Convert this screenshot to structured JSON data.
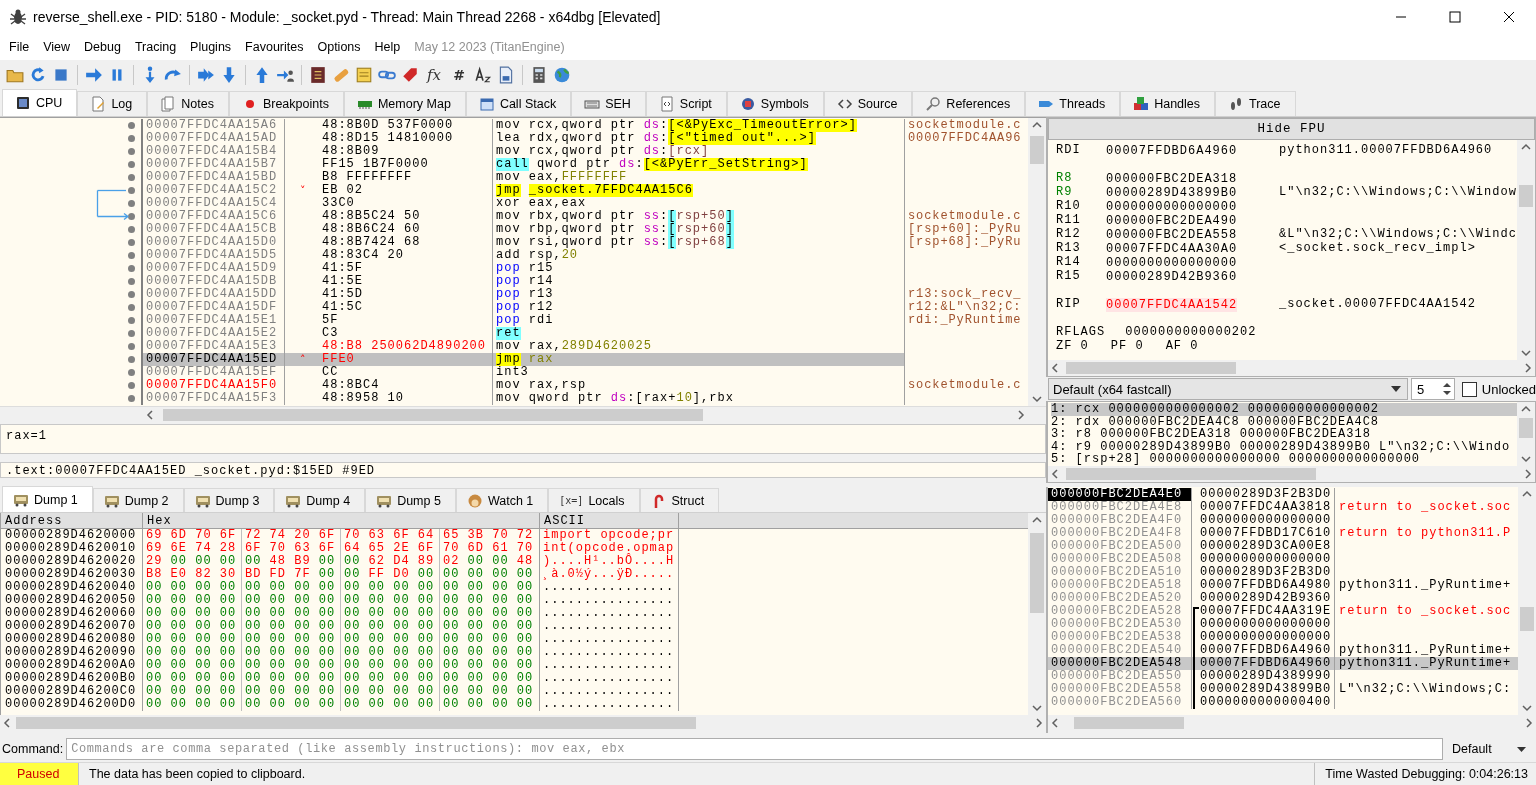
{
  "window": {
    "title": "reverse_shell.exe - PID: 5180 - Module: _socket.pyd - Thread: Main Thread 2268 - x64dbg [Elevated]"
  },
  "menu": {
    "items": [
      "File",
      "View",
      "Debug",
      "Tracing",
      "Plugins",
      "Favourites",
      "Options",
      "Help"
    ],
    "build": "May 12 2023 (TitanEngine)"
  },
  "toolbar": {
    "glyphs": [
      "fx",
      "#"
    ]
  },
  "tabs": [
    {
      "label": "CPU",
      "selected": true
    },
    {
      "label": "Log",
      "selected": false
    },
    {
      "label": "Notes",
      "selected": false
    },
    {
      "label": "Breakpoints",
      "selected": false
    },
    {
      "label": "Memory Map",
      "selected": false
    },
    {
      "label": "Call Stack",
      "selected": false
    },
    {
      "label": "SEH",
      "selected": false
    },
    {
      "label": "Script",
      "selected": false
    },
    {
      "label": "Symbols",
      "selected": false
    },
    {
      "label": "Source",
      "selected": false
    },
    {
      "label": "References",
      "selected": false
    },
    {
      "label": "Threads",
      "selected": false
    },
    {
      "label": "Handles",
      "selected": false
    },
    {
      "label": "Trace",
      "selected": false
    }
  ],
  "disassembly": {
    "rows": [
      {
        "address": "00007FFDC4AA15A6",
        "bytes": "48:8B0D 537F0000",
        "patched": false,
        "jump_source": false,
        "jump_target": false,
        "tokens": [
          {
            "text": "mov",
            "kind": "mnemonic"
          },
          {
            "text": "rcx,qword ptr ",
            "kind": "plain"
          },
          {
            "text": "ds",
            "kind": "seg"
          },
          {
            "text": ":",
            "kind": "plain"
          },
          {
            "text": "[<&PyExc_TimeoutError>]",
            "kind": "sym"
          }
        ],
        "comment": "socketmodule.c",
        "selected": false,
        "address_highlight": false
      },
      {
        "address": "00007FFDC4AA15AD",
        "bytes": "48:8D15 14810000",
        "patched": false,
        "jump_source": false,
        "jump_target": false,
        "tokens": [
          {
            "text": "lea",
            "kind": "mnemonic"
          },
          {
            "text": "rdx,qword ptr ",
            "kind": "plain"
          },
          {
            "text": "ds",
            "kind": "seg"
          },
          {
            "text": ":",
            "kind": "plain"
          },
          {
            "text": "[<\"timed out\"...>]",
            "kind": "sym"
          }
        ],
        "comment": "00007FFDC4AA96",
        "selected": false,
        "address_highlight": false
      },
      {
        "address": "00007FFDC4AA15B4",
        "bytes": "48:8B09",
        "patched": false,
        "jump_source": false,
        "jump_target": false,
        "tokens": [
          {
            "text": "mov",
            "kind": "mnemonic"
          },
          {
            "text": "rcx,qword ptr ",
            "kind": "plain"
          },
          {
            "text": "ds",
            "kind": "seg"
          },
          {
            "text": ":",
            "kind": "plain"
          },
          {
            "text": "[rcx]",
            "kind": "mem"
          }
        ],
        "selected": false,
        "address_highlight": false
      },
      {
        "address": "00007FFDC4AA15B7",
        "bytes": "FF15 1B7F0000",
        "patched": false,
        "jump_source": false,
        "jump_target": false,
        "tokens": [
          {
            "text": "call",
            "kind": "call"
          },
          {
            "text": "qword ptr ",
            "kind": "plain"
          },
          {
            "text": "ds",
            "kind": "seg"
          },
          {
            "text": ":",
            "kind": "plain"
          },
          {
            "text": "[<&PyErr_SetString>]",
            "kind": "sym"
          }
        ],
        "selected": false,
        "address_highlight": false
      },
      {
        "address": "00007FFDC4AA15BD",
        "bytes": "B8 FFFFFFFF",
        "patched": false,
        "jump_source": false,
        "jump_target": false,
        "tokens": [
          {
            "text": "mov",
            "kind": "mnemonic"
          },
          {
            "text": "eax,",
            "kind": "plain"
          },
          {
            "text": "FFFFFFFF",
            "kind": "num"
          }
        ],
        "selected": false,
        "address_highlight": false
      },
      {
        "address": "00007FFDC4AA15C2",
        "jump_mark": "˅",
        "bytes": "EB 02",
        "patched": false,
        "jump_source": true,
        "jump_target": false,
        "tokens": [
          {
            "text": "jmp",
            "kind": "jmp"
          },
          {
            "text": "_socket.7FFDC4AA15C6",
            "kind": "sym"
          }
        ],
        "selected": false,
        "address_highlight": false
      },
      {
        "address": "00007FFDC4AA15C4",
        "bytes": "33C0",
        "patched": false,
        "jump_source": false,
        "jump_target": false,
        "tokens": [
          {
            "text": "xor",
            "kind": "mnemonic"
          },
          {
            "text": "eax,eax",
            "kind": "plain"
          }
        ],
        "selected": false,
        "address_highlight": false
      },
      {
        "address": "00007FFDC4AA15C6",
        "bytes": "48:8B5C24 50",
        "patched": false,
        "jump_source": false,
        "jump_target": true,
        "tokens": [
          {
            "text": "mov",
            "kind": "mnemonic"
          },
          {
            "text": "rbx,qword ptr ",
            "kind": "plain"
          },
          {
            "text": "ss",
            "kind": "seg"
          },
          {
            "text": ":",
            "kind": "plain"
          },
          {
            "text": "[rsp+50]",
            "kind": "stack"
          }
        ],
        "comment": "socketmodule.c",
        "selected": false,
        "address_highlight": false
      },
      {
        "address": "00007FFDC4AA15CB",
        "bytes": "48:8B6C24 60",
        "patched": false,
        "jump_source": false,
        "jump_target": false,
        "tokens": [
          {
            "text": "mov",
            "kind": "mnemonic"
          },
          {
            "text": "rbp,qword ptr ",
            "kind": "plain"
          },
          {
            "text": "ss",
            "kind": "seg"
          },
          {
            "text": ":",
            "kind": "plain"
          },
          {
            "text": "[rsp+60]",
            "kind": "stack"
          }
        ],
        "comment": "[rsp+60]:_PyRu",
        "selected": false,
        "address_highlight": false
      },
      {
        "address": "00007FFDC4AA15D0",
        "bytes": "48:8B7424 68",
        "patched": false,
        "jump_source": false,
        "jump_target": false,
        "tokens": [
          {
            "text": "mov",
            "kind": "mnemonic"
          },
          {
            "text": "rsi,qword ptr ",
            "kind": "plain"
          },
          {
            "text": "ss",
            "kind": "seg"
          },
          {
            "text": ":",
            "kind": "plain"
          },
          {
            "text": "[rsp+68]",
            "kind": "stack"
          }
        ],
        "comment": "[rsp+68]:_PyRu",
        "selected": false,
        "address_highlight": false
      },
      {
        "address": "00007FFDC4AA15D5",
        "bytes": "48:83C4 20",
        "patched": false,
        "jump_source": false,
        "jump_target": false,
        "tokens": [
          {
            "text": "add",
            "kind": "mnemonic"
          },
          {
            "text": "rsp,",
            "kind": "plain"
          },
          {
            "text": "20",
            "kind": "num"
          }
        ],
        "selected": false,
        "address_highlight": false
      },
      {
        "address": "00007FFDC4AA15D9",
        "bytes": "41:5F",
        "patched": false,
        "jump_source": false,
        "jump_target": false,
        "tokens": [
          {
            "text": "pop",
            "kind": "pop"
          },
          {
            "text": "r15",
            "kind": "plain"
          }
        ],
        "selected": false,
        "address_highlight": false
      },
      {
        "address": "00007FFDC4AA15DB",
        "bytes": "41:5E",
        "patched": false,
        "jump_source": false,
        "jump_target": false,
        "tokens": [
          {
            "text": "pop",
            "kind": "pop"
          },
          {
            "text": "r14",
            "kind": "plain"
          }
        ],
        "selected": false,
        "address_highlight": false
      },
      {
        "address": "00007FFDC4AA15DD",
        "bytes": "41:5D",
        "patched": false,
        "jump_source": false,
        "jump_target": false,
        "tokens": [
          {
            "text": "pop",
            "kind": "pop"
          },
          {
            "text": "r13",
            "kind": "plain"
          }
        ],
        "comment": "r13:sock_recv_",
        "selected": false,
        "address_highlight": false
      },
      {
        "address": "00007FFDC4AA15DF",
        "bytes": "41:5C",
        "patched": false,
        "jump_source": false,
        "jump_target": false,
        "tokens": [
          {
            "text": "pop",
            "kind": "pop"
          },
          {
            "text": "r12",
            "kind": "plain"
          }
        ],
        "comment": "r12:&L\"\\n32;C:",
        "selected": false,
        "address_highlight": false
      },
      {
        "address": "00007FFDC4AA15E1",
        "bytes": "5F",
        "patched": false,
        "jump_source": false,
        "jump_target": false,
        "tokens": [
          {
            "text": "pop",
            "kind": "pop"
          },
          {
            "text": "rdi",
            "kind": "plain"
          }
        ],
        "comment": "rdi:_PyRuntime",
        "selected": false,
        "address_highlight": false
      },
      {
        "address": "00007FFDC4AA15E2",
        "bytes": "C3",
        "patched": false,
        "jump_source": false,
        "jump_target": false,
        "tokens": [
          {
            "text": "ret",
            "kind": "call"
          }
        ],
        "selected": false,
        "address_highlight": false
      },
      {
        "address": "00007FFDC4AA15E3",
        "bytes": "48:B8 250062D4890200",
        "patched": true,
        "jump_source": false,
        "jump_target": false,
        "tokens": [
          {
            "text": "mov",
            "kind": "mnemonic"
          },
          {
            "text": "rax,",
            "kind": "plain"
          },
          {
            "text": "289D4620025",
            "kind": "num"
          }
        ],
        "selected": false,
        "address_highlight": false
      },
      {
        "address": "00007FFDC4AA15ED",
        "jump_mark": "˄",
        "bytes": "FFE0",
        "patched": true,
        "jump_source": false,
        "jump_target": false,
        "tokens": [
          {
            "text": "jmp",
            "kind": "jmp"
          },
          {
            "text": "rax",
            "kind": "num"
          }
        ],
        "selected": true,
        "address_highlight": false
      },
      {
        "address": "00007FFDC4AA15EF",
        "bytes": "CC",
        "patched": false,
        "jump_source": false,
        "jump_target": false,
        "tokens": [
          {
            "text": "int3",
            "kind": "mnemonic"
          }
        ],
        "selected": false,
        "address_highlight": false
      },
      {
        "address": "00007FFDC4AA15F0",
        "bytes": "48:8BC4",
        "patched": false,
        "jump_source": false,
        "jump_target": false,
        "tokens": [
          {
            "text": "mov",
            "kind": "mnemonic"
          },
          {
            "text": "rax,rsp",
            "kind": "plain"
          }
        ],
        "comment": "socketmodule.c",
        "selected": false,
        "address_highlight": true
      },
      {
        "address": "00007FFDC4AA15F3",
        "bytes": "48:8958 10",
        "patched": false,
        "jump_source": false,
        "jump_target": false,
        "tokens": [
          {
            "text": "mov",
            "kind": "mnemonic"
          },
          {
            "text": "qword ptr ",
            "kind": "plain"
          },
          {
            "text": "ds",
            "kind": "seg"
          },
          {
            "text": ":",
            "kind": "plain"
          },
          {
            "text": "[rax+",
            "kind": "plain"
          },
          {
            "text": "10",
            "kind": "num"
          },
          {
            "text": "],rbx",
            "kind": "plain"
          }
        ],
        "selected": false,
        "address_highlight": false
      }
    ]
  },
  "info": {
    "lines": [
      "rax=1",
      ".text:00007FFDC4AA15ED _socket.pyd:$15ED #9ED"
    ]
  },
  "registers": {
    "button": "Hide FPU",
    "rows": [
      {
        "kind": "reg",
        "name": "RDI",
        "value": "00007FFDBD6A4960",
        "comment": "python311.00007FFDBD6A4960",
        "changed": false
      },
      {
        "kind": "gap"
      },
      {
        "kind": "reg",
        "name": "R8",
        "value": "000000FBC2DEA318",
        "changed": true
      },
      {
        "kind": "reg",
        "name": "R9",
        "value": "00000289D43899B0",
        "comment": "L\"\\n32;C:\\\\Windows;C:\\\\Window",
        "changed": true
      },
      {
        "kind": "reg",
        "name": "R10",
        "value": "0000000000000000",
        "changed": false
      },
      {
        "kind": "reg",
        "name": "R11",
        "value": "000000FBC2DEA490",
        "changed": false
      },
      {
        "kind": "reg",
        "name": "R12",
        "value": "000000FBC2DEA558",
        "comment": "&L\"\\n32;C:\\\\Windows;C:\\\\Windc",
        "changed": false
      },
      {
        "kind": "reg",
        "name": "R13",
        "value": "00007FFDC4AA30A0",
        "comment": "<_socket.sock_recv_impl>",
        "changed": false
      },
      {
        "kind": "reg",
        "name": "R14",
        "value": "0000000000000000",
        "changed": false
      },
      {
        "kind": "reg",
        "name": "R15",
        "value": "00000289D42B9360",
        "changed": false
      },
      {
        "kind": "gap"
      },
      {
        "kind": "ip",
        "name": "RIP",
        "value": "00007FFDC4AA1542",
        "comment": "_socket.00007FFDC4AA1542",
        "changed": false
      },
      {
        "kind": "gap"
      },
      {
        "kind": "flags",
        "name": "RFLAGS",
        "value": "0000000000000202",
        "changed": false
      }
    ],
    "flags": [
      {
        "name": "ZF",
        "value": "0"
      },
      {
        "name": "PF",
        "value": "0"
      },
      {
        "name": "AF",
        "value": "0"
      }
    ]
  },
  "call_convention": {
    "value": "Default (x64 fastcall)",
    "count": "5",
    "unlocked_label": "Unlocked",
    "unlocked": false,
    "args": [
      {
        "text": "1: rcx 0000000000000002 0000000000000002",
        "selected": true
      },
      {
        "text": "2: rdx 000000FBC2DEA4C8 000000FBC2DEA4C8",
        "selected": false
      },
      {
        "text": "3: r8 000000FBC2DEA318 000000FBC2DEA318",
        "selected": false
      },
      {
        "text": "4: r9 00000289D43899B0 00000289D43899B0 L\"\\n32;C:\\\\Windo",
        "selected": false
      },
      {
        "text": "5: [rsp+28] 0000000000000000 0000000000000000",
        "selected": false
      }
    ]
  },
  "dump_tabs": [
    {
      "label": "Dump 1",
      "selected": true
    },
    {
      "label": "Dump 2",
      "selected": false
    },
    {
      "label": "Dump 3",
      "selected": false
    },
    {
      "label": "Dump 4",
      "selected": false
    },
    {
      "label": "Dump 5",
      "selected": false
    },
    {
      "label": "Watch 1",
      "selected": false
    },
    {
      "label": "Locals",
      "glyph": "[x=]",
      "selected": false
    },
    {
      "label": "Struct",
      "selected": false
    }
  ],
  "dump": {
    "columns": [
      "Address",
      "Hex",
      "ASCII"
    ],
    "rows": [
      {
        "address": "00000289D4620000",
        "hex": "69 6D 70 6F 72 74 20 6F 70 63 6F 64 65 3B 70 72",
        "changed": [
          true,
          true,
          true,
          true,
          true,
          true,
          true,
          true,
          true,
          true,
          true,
          true,
          true,
          true,
          true,
          true
        ],
        "ascii": "import opcode;pr",
        "ascii_changed": true
      },
      {
        "address": "00000289D4620010",
        "hex": "69 6E 74 28 6F 70 63 6F 64 65 2E 6F 70 6D 61 70",
        "changed": [
          true,
          true,
          true,
          true,
          true,
          true,
          true,
          true,
          true,
          true,
          true,
          true,
          true,
          true,
          true,
          true
        ],
        "ascii": "int(opcode.opmap",
        "ascii_changed": true
      },
      {
        "address": "00000289D4620020",
        "hex": "29 00 00 00 00 48 B9 00 00 62 D4 89 02 00 00 48",
        "changed": [
          true,
          false,
          false,
          false,
          false,
          true,
          true,
          false,
          false,
          true,
          true,
          true,
          true,
          false,
          false,
          true
        ],
        "ascii": ")....H¹..bÔ....H",
        "ascii_changed": true
      },
      {
        "address": "00000289D4620030",
        "hex": "B8 E0 82 30 BD FD 7F 00 00 FF D0 00 00 00 00 00",
        "changed": [
          true,
          true,
          true,
          true,
          true,
          true,
          true,
          false,
          false,
          true,
          true,
          false,
          false,
          false,
          false,
          false
        ],
        "ascii": "¸à.0½ý...ÿÐ.....",
        "ascii_changed": true
      },
      {
        "address": "00000289D4620040",
        "hex": "00 00 00 00 00 00 00 00 00 00 00 00 00 00 00 00",
        "changed": [
          false,
          false,
          false,
          false,
          false,
          false,
          false,
          false,
          false,
          false,
          false,
          false,
          false,
          false,
          false,
          false
        ],
        "ascii": "................",
        "ascii_changed": false
      },
      {
        "address": "00000289D4620050",
        "hex": "00 00 00 00 00 00 00 00 00 00 00 00 00 00 00 00",
        "changed": [
          false,
          false,
          false,
          false,
          false,
          false,
          false,
          false,
          false,
          false,
          false,
          false,
          false,
          false,
          false,
          false
        ],
        "ascii": "................",
        "ascii_changed": false
      },
      {
        "address": "00000289D4620060",
        "hex": "00 00 00 00 00 00 00 00 00 00 00 00 00 00 00 00",
        "changed": [
          false,
          false,
          false,
          false,
          false,
          false,
          false,
          false,
          false,
          false,
          false,
          false,
          false,
          false,
          false,
          false
        ],
        "ascii": "................",
        "ascii_changed": false
      },
      {
        "address": "00000289D4620070",
        "hex": "00 00 00 00 00 00 00 00 00 00 00 00 00 00 00 00",
        "changed": [
          false,
          false,
          false,
          false,
          false,
          false,
          false,
          false,
          false,
          false,
          false,
          false,
          false,
          false,
          false,
          false
        ],
        "ascii": "................",
        "ascii_changed": false
      },
      {
        "address": "00000289D4620080",
        "hex": "00 00 00 00 00 00 00 00 00 00 00 00 00 00 00 00",
        "changed": [
          false,
          false,
          false,
          false,
          false,
          false,
          false,
          false,
          false,
          false,
          false,
          false,
          false,
          false,
          false,
          false
        ],
        "ascii": "................",
        "ascii_changed": false
      },
      {
        "address": "00000289D4620090",
        "hex": "00 00 00 00 00 00 00 00 00 00 00 00 00 00 00 00",
        "changed": [
          false,
          false,
          false,
          false,
          false,
          false,
          false,
          false,
          false,
          false,
          false,
          false,
          false,
          false,
          false,
          false
        ],
        "ascii": "................",
        "ascii_changed": false
      },
      {
        "address": "00000289D46200A0",
        "hex": "00 00 00 00 00 00 00 00 00 00 00 00 00 00 00 00",
        "changed": [
          false,
          false,
          false,
          false,
          false,
          false,
          false,
          false,
          false,
          false,
          false,
          false,
          false,
          false,
          false,
          false
        ],
        "ascii": "................",
        "ascii_changed": false
      },
      {
        "address": "00000289D46200B0",
        "hex": "00 00 00 00 00 00 00 00 00 00 00 00 00 00 00 00",
        "changed": [
          false,
          false,
          false,
          false,
          false,
          false,
          false,
          false,
          false,
          false,
          false,
          false,
          false,
          false,
          false,
          false
        ],
        "ascii": "................",
        "ascii_changed": false
      },
      {
        "address": "00000289D46200C0",
        "hex": "00 00 00 00 00 00 00 00 00 00 00 00 00 00 00 00",
        "changed": [
          false,
          false,
          false,
          false,
          false,
          false,
          false,
          false,
          false,
          false,
          false,
          false,
          false,
          false,
          false,
          false
        ],
        "ascii": "................",
        "ascii_changed": false
      },
      {
        "address": "00000289D46200D0",
        "hex": "00 00 00 00 00 00 00 00 00 00 00 00 00 00 00 00",
        "changed": [
          false,
          false,
          false,
          false,
          false,
          false,
          false,
          false,
          false,
          false,
          false,
          false,
          false,
          false,
          false,
          false
        ],
        "ascii": "................",
        "ascii_changed": false
      }
    ]
  },
  "stack": {
    "rows": [
      {
        "address": "000000FBC2DEA4E0",
        "value": "00000289D3F2B3D0",
        "top": true,
        "selected": false,
        "in_frame": false
      },
      {
        "address": "000000FBC2DEA4E8",
        "value": "00007FFDC4AA3818",
        "comment": "return to _socket.soc",
        "return": true,
        "top": false,
        "selected": false,
        "in_frame": false
      },
      {
        "address": "000000FBC2DEA4F0",
        "value": "0000000000000000",
        "top": false,
        "selected": false,
        "in_frame": false
      },
      {
        "address": "000000FBC2DEA4F8",
        "value": "00007FFDBD17C610",
        "comment": "return to python311.P",
        "return": true,
        "top": false,
        "selected": false,
        "in_frame": false
      },
      {
        "address": "000000FBC2DEA500",
        "value": "00000289D3CA00E8",
        "top": false,
        "selected": false,
        "in_frame": false
      },
      {
        "address": "000000FBC2DEA508",
        "value": "0000000000000000",
        "top": false,
        "selected": false,
        "in_frame": false
      },
      {
        "address": "000000FBC2DEA510",
        "value": "00000289D3F2B3D0",
        "top": false,
        "selected": false,
        "in_frame": false
      },
      {
        "address": "000000FBC2DEA518",
        "value": "00007FFDBD6A4980",
        "comment": "python311._PyRuntime+",
        "return": false,
        "top": false,
        "selected": false,
        "in_frame": false
      },
      {
        "address": "000000FBC2DEA520",
        "value": "00000289D42B9360",
        "top": false,
        "selected": false,
        "in_frame": false
      },
      {
        "address": "000000FBC2DEA528",
        "value": "00007FFDC4AA319E",
        "comment": "return to _socket.soc",
        "return": true,
        "top": false,
        "selected": false,
        "in_frame": true
      },
      {
        "address": "000000FBC2DEA530",
        "value": "0000000000000000",
        "top": false,
        "selected": false,
        "in_frame": true
      },
      {
        "address": "000000FBC2DEA538",
        "value": "0000000000000000",
        "top": false,
        "selected": false,
        "in_frame": true
      },
      {
        "address": "000000FBC2DEA540",
        "value": "00007FFDBD6A4960",
        "comment": "python311._PyRuntime+",
        "return": false,
        "top": false,
        "selected": false,
        "in_frame": true
      },
      {
        "address": "000000FBC2DEA548",
        "value": "00007FFDBD6A4960",
        "comment": "python311._PyRuntime+",
        "return": false,
        "top": false,
        "selected": true,
        "in_frame": true
      },
      {
        "address": "000000FBC2DEA550",
        "value": "00000289D4389990",
        "top": false,
        "selected": false,
        "in_frame": true
      },
      {
        "address": "000000FBC2DEA558",
        "value": "00000289D43899B0",
        "comment": "L\"\\n32;C:\\\\Windows;C:",
        "return": false,
        "top": false,
        "selected": false,
        "in_frame": true
      },
      {
        "address": "000000FBC2DEA560",
        "value": "0000000000000400",
        "top": false,
        "selected": false,
        "in_frame": true
      }
    ]
  },
  "command": {
    "label": "Command:",
    "placeholder": "Commands are comma separated (like assembly instructions): mov eax, ebx",
    "mode": "Default"
  },
  "status": {
    "state": "Paused",
    "message": "The data has been copied to clipboard.",
    "time": "Time Wasted Debugging: 0:04:26:13"
  }
}
